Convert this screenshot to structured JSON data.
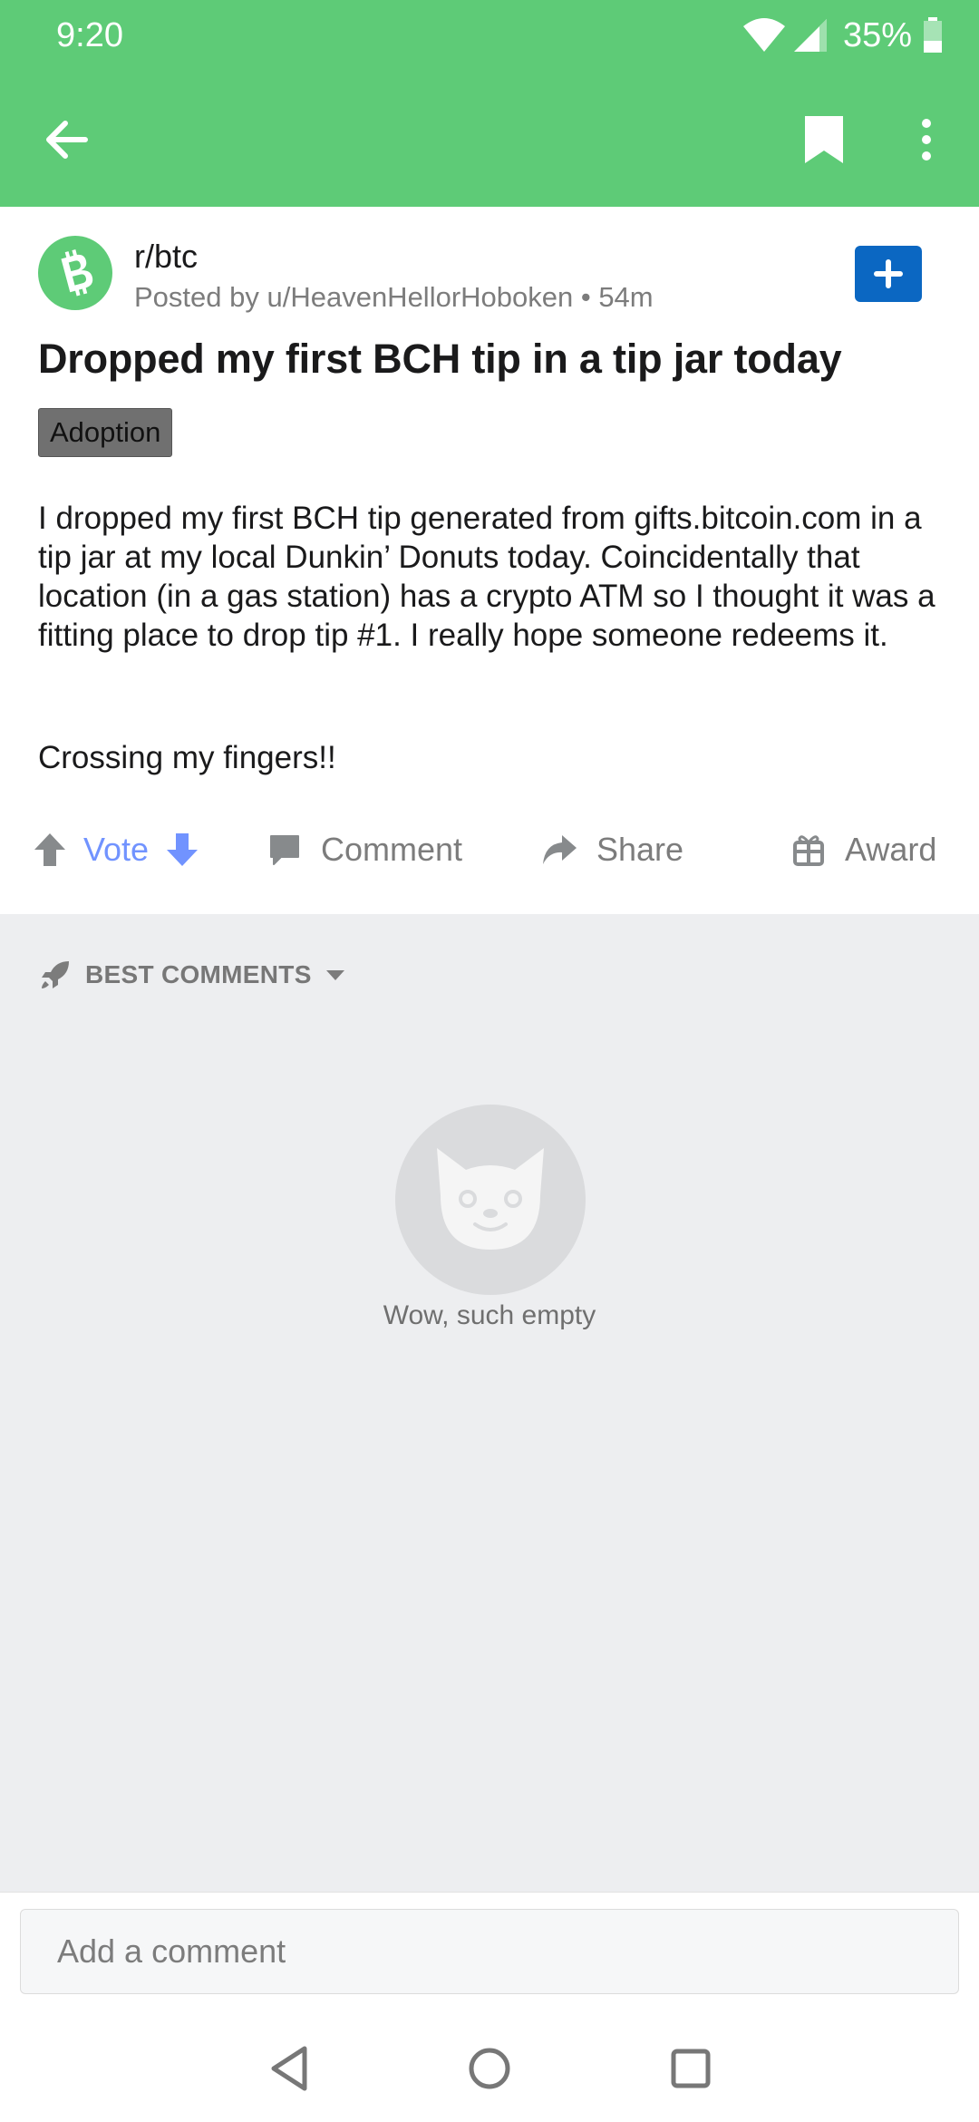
{
  "status": {
    "time": "9:20",
    "battery": "35%"
  },
  "appbar": {
    "icons": [
      "back-arrow-icon",
      "bookmark-icon",
      "more-vert-icon"
    ]
  },
  "post": {
    "subreddit": "r/btc",
    "posted_by": "Posted by u/HeavenHellorHoboken • 54m",
    "title": "Dropped my first BCH tip in a tip jar today",
    "flair": "Adoption",
    "body": "I dropped my first BCH tip generated from gifts.bitcoin.com in a tip jar at my local Dunkin’ Donuts today. Coincidentally that location (in a gas station) has a crypto ATM so I thought it was a fitting place to drop tip #1. I really hope someone redeems it.",
    "body2": "Crossing my fingers!!",
    "colors": {
      "accent": "#5ecb77",
      "join": "#0b67c2",
      "vote": "#7193ff"
    }
  },
  "actions": {
    "vote": "Vote",
    "comment": "Comment",
    "share": "Share",
    "award": "Award"
  },
  "comments": {
    "sort_label": "BEST COMMENTS",
    "empty_text": "Wow, such empty"
  },
  "composer": {
    "placeholder": "Add a comment"
  }
}
